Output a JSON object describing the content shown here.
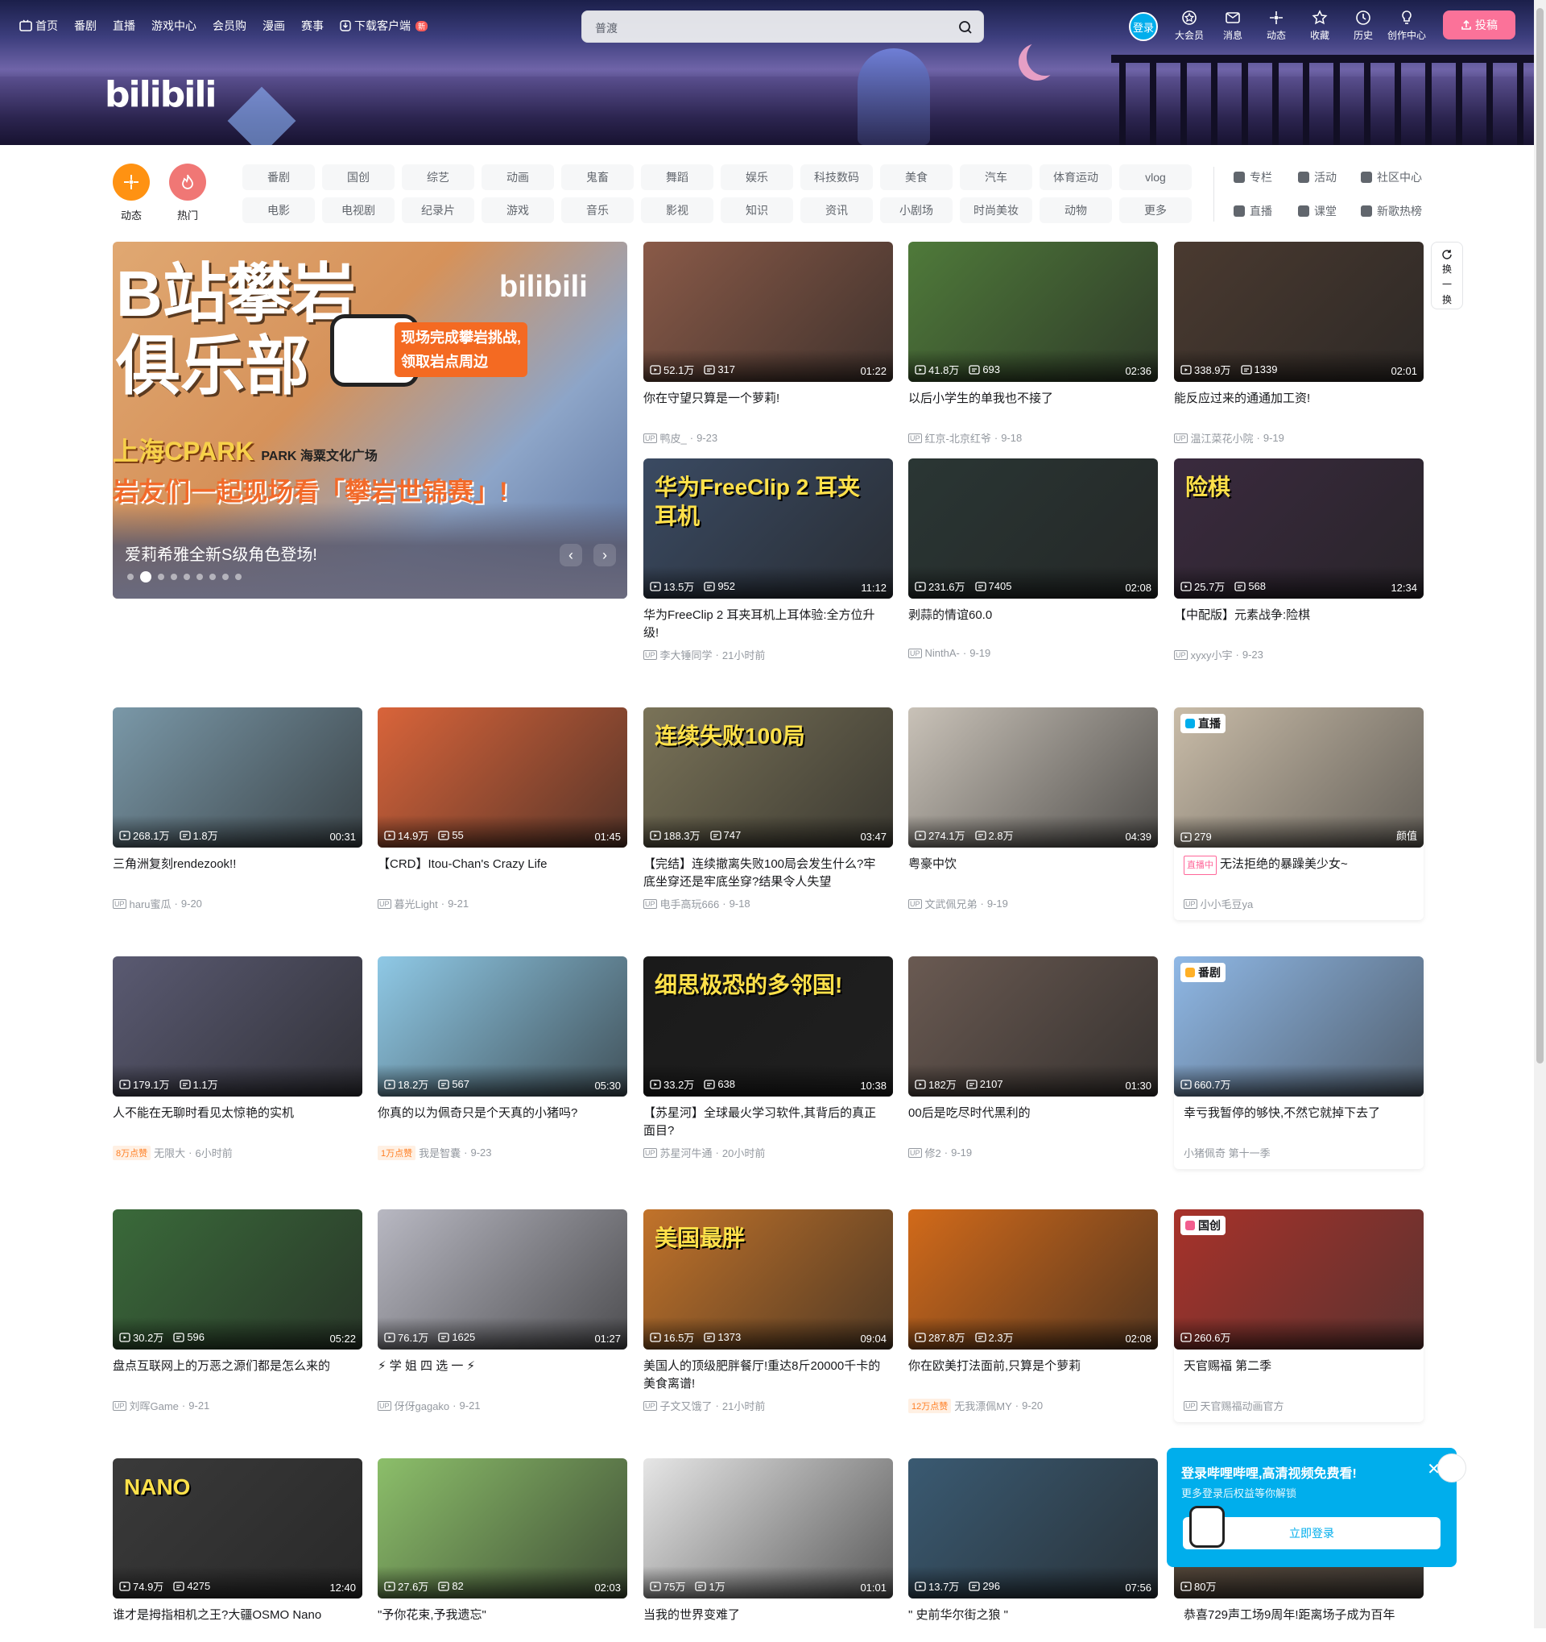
{
  "topnav": {
    "left": [
      "首页",
      "番剧",
      "直播",
      "游戏中心",
      "会员购",
      "漫画",
      "赛事",
      "下载客户端"
    ],
    "new_badge": "新",
    "search_placeholder": "普渡",
    "login": "登录",
    "right": [
      {
        "label": "大会员",
        "icon": "vip-icon"
      },
      {
        "label": "消息",
        "icon": "message-icon"
      },
      {
        "label": "动态",
        "icon": "dynamic-icon"
      },
      {
        "label": "收藏",
        "icon": "favorite-icon"
      },
      {
        "label": "历史",
        "icon": "history-icon"
      },
      {
        "label": "创作中心",
        "icon": "creator-icon"
      }
    ],
    "upload": "投稿"
  },
  "banner": {
    "logo": "bilibili"
  },
  "channels": {
    "dynamic": "动态",
    "hot": "热门",
    "row1": [
      "番剧",
      "国创",
      "综艺",
      "动画",
      "鬼畜",
      "舞蹈",
      "娱乐",
      "科技数码",
      "美食",
      "汽车",
      "体育运动",
      "vlog"
    ],
    "row2": [
      "电影",
      "电视剧",
      "纪录片",
      "游戏",
      "音乐",
      "影视",
      "知识",
      "资讯",
      "小剧场",
      "时尚美妆",
      "动物",
      "更多"
    ],
    "right1": [
      "专栏",
      "活动",
      "社区中心"
    ],
    "right2": [
      "直播",
      "课堂",
      "新歌热榜"
    ]
  },
  "carousel": {
    "big1": "B站攀岩",
    "big2": "俱乐部",
    "bubble1": "现场完成攀岩挑战,",
    "bubble2": "领取岩点周边",
    "park": "上海CPARK",
    "park2": "PARK 海粟文化广场",
    "sub2": "岩友们一起现场看「攀岩世锦赛」!",
    "title": "爱莉希雅全新S级角色登场!"
  },
  "refresh": [
    "换",
    "一",
    "换"
  ],
  "cards": [
    {
      "plays": "52.1万",
      "danmaku": "317",
      "dur": "01:22",
      "title": "你在守望只算是一个萝莉!",
      "author": "鸭皮_",
      "date": "9-23",
      "color": "#8a5a48"
    },
    {
      "plays": "41.8万",
      "danmaku": "693",
      "dur": "02:36",
      "title": "以后小学生的单我也不接了",
      "author": "红京-北京红爷",
      "date": "9-18",
      "color": "#4f7a3a"
    },
    {
      "plays": "338.9万",
      "danmaku": "1339",
      "dur": "02:01",
      "title": "能反应过来的通通加工资!",
      "author": "温江菜花小院",
      "date": "9-19",
      "color": "#4a3a30"
    },
    {
      "plays": "13.5万",
      "danmaku": "952",
      "dur": "11:12",
      "title": "华为FreeClip 2 耳夹耳机上耳体验:全方位升级!",
      "author": "李大锤同学",
      "date": "21小时前",
      "color": "#3a4a62",
      "over": "华为FreeClip 2 耳夹耳机"
    },
    {
      "plays": "231.6万",
      "danmaku": "7405",
      "dur": "02:08",
      "title": "剥蒜的情谊60.0",
      "author": "NinthA-",
      "date": "9-19",
      "color": "#2a3634"
    },
    {
      "plays": "25.7万",
      "danmaku": "568",
      "dur": "12:34",
      "title": "【中配版】元素战争:险棋",
      "author": "xyxy小宇",
      "date": "9-23",
      "color": "#3a2a3e",
      "over": "险棋"
    },
    {
      "plays": "268.1万",
      "danmaku": "1.8万",
      "dur": "00:31",
      "title": "三角洲复刻rendezook!!",
      "author": "haru蜜瓜",
      "date": "9-20",
      "color": "#7a98a8"
    },
    {
      "plays": "14.9万",
      "danmaku": "55",
      "dur": "01:45",
      "title": "【CRD】Itou-Chan's Crazy Life",
      "author": "暮光Light",
      "date": "9-21",
      "color": "#d9643a"
    },
    {
      "plays": "188.3万",
      "danmaku": "747",
      "dur": "03:47",
      "title": "【完结】连续撤离失败100局会发生什么?牢底坐穿还是牢底坐穿?结果令人失望",
      "author": "电手高玩666",
      "date": "9-18",
      "color": "#7a7358",
      "over": "连续失败100局"
    },
    {
      "plays": "274.1万",
      "danmaku": "2.8万",
      "dur": "04:39",
      "title": "粤豪中饮",
      "author": "文武佩兄弟",
      "date": "9-19",
      "color": "#c9c2b8"
    },
    {
      "plays": "179.1万",
      "danmaku": "1.1万",
      "dur": "",
      "title": "人不能在无聊时看见太惊艳的实机",
      "author": "无限大",
      "date": "6小时前",
      "badge": "8万点赞",
      "color": "#5a5a72"
    },
    {
      "plays": "18.2万",
      "danmaku": "567",
      "dur": "05:30",
      "title": "你真的以为佩奇只是个天真的小猪吗?",
      "author": "我是智囊",
      "date": "9-23",
      "badge": "1万点赞",
      "color": "#8fc9e6"
    },
    {
      "plays": "33.2万",
      "danmaku": "638",
      "dur": "10:38",
      "title": "【苏星河】全球最火学习软件,其背后的真正面目?",
      "author": "苏星河牛通",
      "date": "20小时前",
      "color": "#1a1a1a",
      "over": "细思极恐的多邻国!"
    },
    {
      "plays": "182万",
      "danmaku": "2107",
      "dur": "01:30",
      "title": "00后是吃尽时代黑利的",
      "author": "修2",
      "date": "9-19",
      "color": "#6a5a52"
    },
    {
      "plays": "30.2万",
      "danmaku": "596",
      "dur": "05:22",
      "title": "盘点互联网上的万恶之源们都是怎么来的",
      "author": "刘晖Game",
      "date": "9-21",
      "color": "#3a6a3a"
    },
    {
      "plays": "76.1万",
      "danmaku": "1625",
      "dur": "01:27",
      "title": "⚡ 学 姐 四 选 一 ⚡",
      "author": "伢伢gagako",
      "date": "9-21",
      "color": "#b8b8c2"
    },
    {
      "plays": "16.5万",
      "danmaku": "1373",
      "dur": "09:04",
      "title": "美国人的顶级肥胖餐厅!重达8斤20000千卡的美食离谱!",
      "author": "子文又饿了",
      "date": "21小时前",
      "color": "#c2732a",
      "over": "美国最胖"
    },
    {
      "plays": "287.8万",
      "danmaku": "2.3万",
      "dur": "02:08",
      "title": "你在欧美打法面前,只算是个萝莉",
      "author": "无我漂佩MY",
      "date": "9-20",
      "badge": "12万点赞",
      "color": "#d26a1a"
    },
    {
      "plays": "74.9万",
      "danmaku": "4275",
      "dur": "12:40",
      "title": "谁才是拇指相机之王?大疆OSMO Nano",
      "author": "",
      "date": "",
      "color": "#3a3a3a",
      "over": "NANO"
    },
    {
      "plays": "27.6万",
      "danmaku": "82",
      "dur": "02:03",
      "title": "\"予你花束,予我遗忘\"",
      "author": "",
      "date": "",
      "color": "#8cbf6a"
    },
    {
      "plays": "75万",
      "danmaku": "1万",
      "dur": "01:01",
      "title": "当我的世界变难了",
      "author": "",
      "date": "",
      "color": "#e6e6e6"
    },
    {
      "plays": "13.7万",
      "danmaku": "296",
      "dur": "07:56",
      "title": "\" 史前华尔街之狼 \"",
      "author": "",
      "date": "",
      "color": "#3a5a72"
    }
  ],
  "specials": [
    {
      "label": "直播",
      "stat": "279",
      "tag": "颜值",
      "live": "直播中",
      "title": "无法拒绝的暴躁美少女~",
      "author": "小小毛豆ya",
      "color": "#c9bca8"
    },
    {
      "label": "番剧",
      "stat": "660.7万",
      "title": "幸亏我暂停的够快,不然它就掉下去了",
      "author": "小猪佩奇 第十一季",
      "color": "#8fb8e6"
    },
    {
      "label": "国创",
      "stat": "260.6万",
      "title": "天官赐福 第二季",
      "author": "天官赐福动画官方",
      "color": "#a8322a"
    },
    {
      "label": "",
      "stat": "80万",
      "title": "恭喜729声工场9周年!距离场子成为百年",
      "author": "",
      "color": "#5a4a3a"
    }
  ],
  "popup": {
    "title": "登录哔哩哔哩,高清视频免费看!",
    "sub": "更多登录后权益等你解锁",
    "button": "立即登录"
  }
}
